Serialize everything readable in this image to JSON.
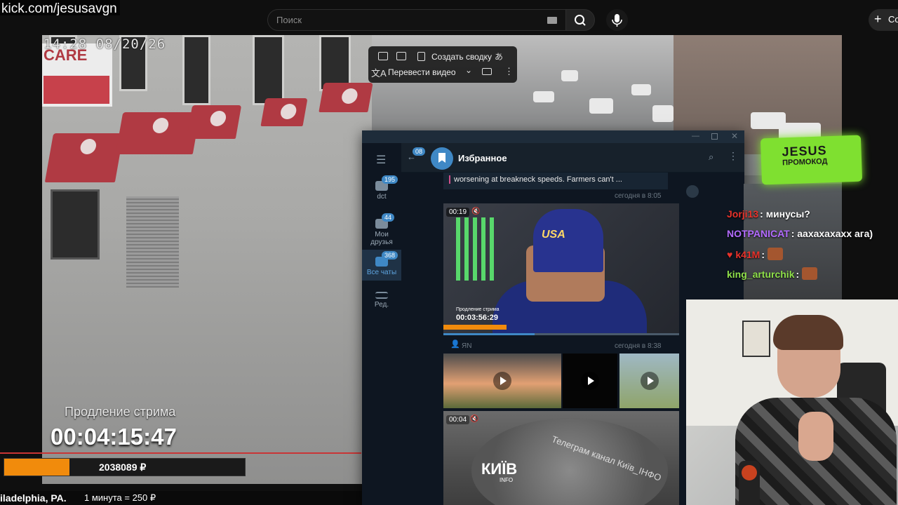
{
  "browser": {
    "url": "kick.com/jesusavgn",
    "search_placeholder": "Поиск",
    "create_label": "Со"
  },
  "stream": {
    "camera_timestamp": "14:28  08/20/26",
    "extension_label": "Продление стрима",
    "extension_timer": "00:04:15:47",
    "donation_total": "2038089 ₽",
    "donation_progress": 0.27,
    "location": "iladelphia, PA.",
    "rate": "1 минута = 250 ₽",
    "care_sign": "CARE"
  },
  "video_toolbar": {
    "summary_button": "Создать сводку",
    "translate_button": "Перевести видео"
  },
  "telegram": {
    "chat_title": "Избранное",
    "back_badge": "08",
    "folders": [
      {
        "label": "dct",
        "badge": "195",
        "icon": "folder-icon"
      },
      {
        "label": "Мои друзья",
        "badge": "44",
        "icon": "folder-icon"
      },
      {
        "label": "Все чаты",
        "badge": "368",
        "icon": "chats-icon"
      },
      {
        "label": "Ред.",
        "badge": "",
        "icon": "sliders-icon"
      }
    ],
    "message_preview": "worsening at breakneck speeds. Farmers can't ...",
    "time1": "сегодня в 8:05",
    "time2": "сегодня в 8:38",
    "video1_duration": "00:19",
    "video1_label": "Продление стрима",
    "video1_clock": "00:03:56:29",
    "video1_cap_text": "USA",
    "forwarded_from": "ЯN",
    "video2_duration": "00:04",
    "video2_brand": "КИЇВ",
    "video2_brand_sub": "INFO",
    "video2_watermark": "Телеграм канал Київ_ІНФО"
  },
  "promo": {
    "title": "JESUS",
    "subtitle": "ПРОМОКОД"
  },
  "chat": [
    {
      "user": "Jorji13",
      "text": ": минусы?",
      "color": "#e8322b"
    },
    {
      "user": "NOTPANICAT",
      "text": ": аахахахахх ага)",
      "color": "#b36bff"
    },
    {
      "user": "k41M",
      "text": ":",
      "color": "#e8322b"
    },
    {
      "user": "king_arturchik",
      "text": ":",
      "color": "#8fe04a"
    }
  ],
  "colors": {
    "accent_orange": "#f18b0c",
    "telegram_blue": "#3f88c5",
    "promo_green": "#7fe030"
  }
}
